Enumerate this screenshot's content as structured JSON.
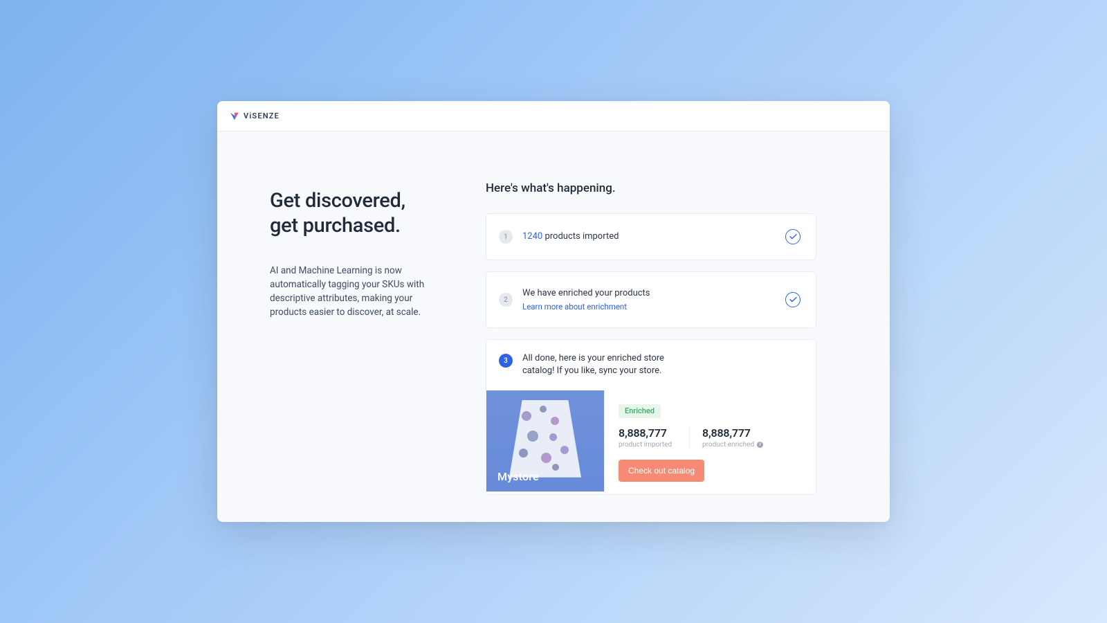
{
  "brand": {
    "name": "ViSENZE"
  },
  "left": {
    "headline_l1": "Get discovered,",
    "headline_l2": "get purchased.",
    "description": "AI and Machine Learning is now automatically tagging your SKUs with descriptive attributes, making your products easier to discover, at scale."
  },
  "right": {
    "subtitle": "Here's what's happening.",
    "step1": {
      "num": "1",
      "count": "1240",
      "suffix": "products imported"
    },
    "step2": {
      "num": "2",
      "text": "We have enriched your products",
      "link": "Learn more about enrichment"
    },
    "step3": {
      "num": "3",
      "text": "All done, here is your enriched store catalog! If you like, sync your store.",
      "store_name": "Mystore",
      "chip": "Enriched",
      "stat1_val": "8,888,777",
      "stat1_lbl": "product imported",
      "stat2_val": "8,888,777",
      "stat2_lbl": "product enriched",
      "cta": "Check out catalog"
    }
  },
  "colors": {
    "primary": "#2E62E6",
    "accent": "#F58B74",
    "success": "#3CA866"
  }
}
